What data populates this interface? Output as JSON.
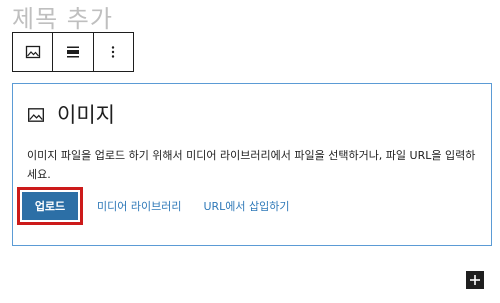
{
  "editor": {
    "title_placeholder": "제목 추가"
  },
  "toolbar": {
    "buttons": [
      {
        "name": "block-type-image",
        "icon": "image-icon"
      },
      {
        "name": "align",
        "icon": "align-icon"
      },
      {
        "name": "more-options",
        "icon": "more-vertical-icon"
      }
    ]
  },
  "image_block": {
    "title": "이미지",
    "icon": "image-icon",
    "instructions": "이미지 파일을 업로드 하기 위해서 미디어 라이브러리에서 파일을 선택하거나, 파일 URL을 입력하세요.",
    "upload_label": "업로드",
    "media_library_label": "미디어 라이브러리",
    "insert_url_label": "URL에서 삽입하기"
  },
  "colors": {
    "accent": "#2c6fa6",
    "link": "#2f79b8",
    "highlight": "#cc1a1a",
    "block_border": "#5b9bd5"
  }
}
